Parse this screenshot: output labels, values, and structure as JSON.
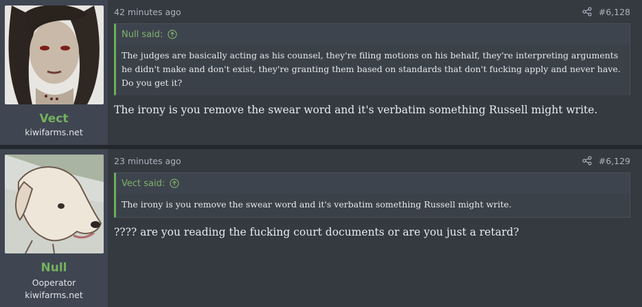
{
  "posts": [
    {
      "username": "Vect",
      "user_title": "",
      "user_banner": "kiwifarms.net",
      "time": "42 minutes ago",
      "number": "#6,128",
      "quote": {
        "author": "Null said:",
        "text": "The judges are basically acting as his counsel, they're filing motions on his behalf, they're interpreting arguments he didn't make and don't exist, they're granting them based on standards that don't fucking apply and never have. Do you get it?"
      },
      "message": "The irony is you remove the swear word and it's verbatim something Russell might write."
    },
    {
      "username": "Null",
      "user_title": "Ooperator",
      "user_banner": "kiwifarms.net",
      "time": "23 minutes ago",
      "number": "#6,129",
      "quote": {
        "author": "Vect said:",
        "text": "The irony is you remove the swear word and it's verbatim something Russell might write."
      },
      "message": "???? are you reading the fucking court documents or are you just a retard?"
    }
  ],
  "colors": {
    "accent_green": "#75b15e",
    "quote_border": "#6bb05b",
    "panel": "#353a41",
    "user_panel": "#3f4651"
  }
}
